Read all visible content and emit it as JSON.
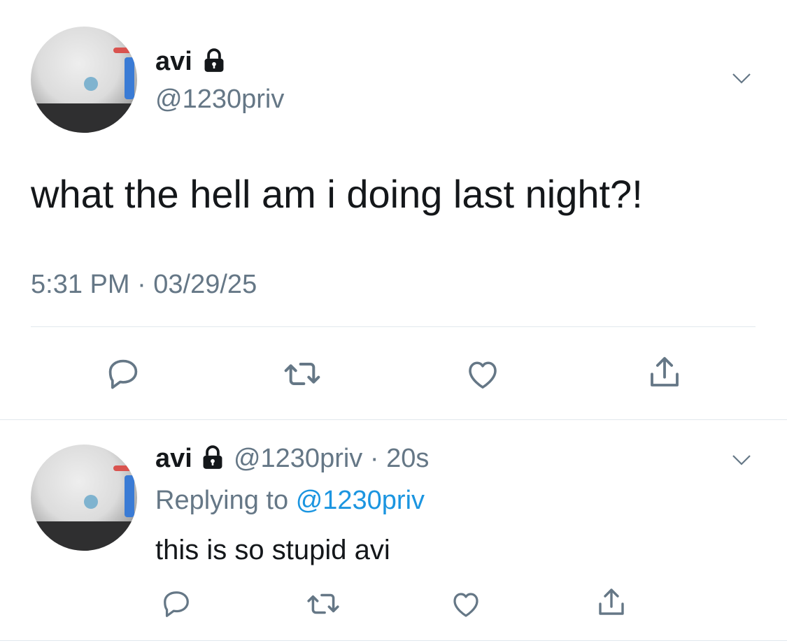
{
  "main_tweet": {
    "display_name": "avi",
    "handle": "@1230priv",
    "text": "what the hell am i doing last night?!",
    "timestamp": "5:31 PM · 03/29/25",
    "icons": [
      "lock-icon",
      "chevron-down-icon",
      "reply-icon",
      "retweet-icon",
      "like-icon",
      "share-icon"
    ]
  },
  "reply_tweet": {
    "display_name": "avi",
    "handle": "@1230priv",
    "separator": "·",
    "age": "20s",
    "replying_prefix": "Replying to",
    "replying_handle": "@1230priv",
    "text": "this is so stupid avi",
    "icons": [
      "lock-icon",
      "chevron-down-icon",
      "reply-icon",
      "retweet-icon",
      "like-icon",
      "share-icon"
    ]
  },
  "colors": {
    "text": "#14171a",
    "secondary": "#657786",
    "link": "#1b95e0",
    "divider": "#e1e8ed",
    "icon": "#657786"
  }
}
